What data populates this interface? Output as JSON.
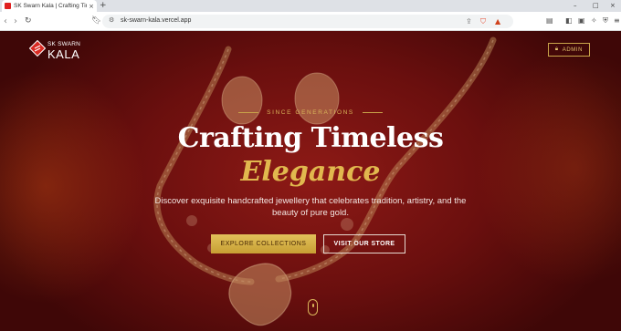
{
  "browser": {
    "tab_title": "SK Swarn Kala | Crafting Timeless",
    "tab_close": "×",
    "new_tab": "+",
    "url": "sk-swarn-kala.vercel.app",
    "window_controls": [
      "–",
      "□",
      "×"
    ]
  },
  "header": {
    "logo_line1": "SK SWARN",
    "logo_line2": "KALA",
    "admin_label": "ADMIN"
  },
  "hero": {
    "eyebrow": "SINCE GENERATIONS",
    "title_line1": "Crafting Timeless",
    "title_line2": "Elegance",
    "subtitle": "Discover exquisite handcrafted jewellery that celebrates tradition, artistry, and the beauty of pure gold.",
    "cta_primary": "EXPLORE COLLECTIONS",
    "cta_secondary": "VISIT OUR STORE"
  },
  "colors": {
    "accent_gold": "#d9b55a",
    "hero_bg": "#6a0f0e",
    "brand_red": "#e02020"
  },
  "icons": {
    "nav": [
      "back-icon",
      "forward-icon",
      "reload-icon"
    ],
    "toolbar": [
      "bookmark-icon",
      "share-icon",
      "brave-shield-icon",
      "alert-icon",
      "sidebar-icon",
      "wallet-icon",
      "extensions-icon",
      "vpn-icon",
      "menu-icon"
    ]
  }
}
